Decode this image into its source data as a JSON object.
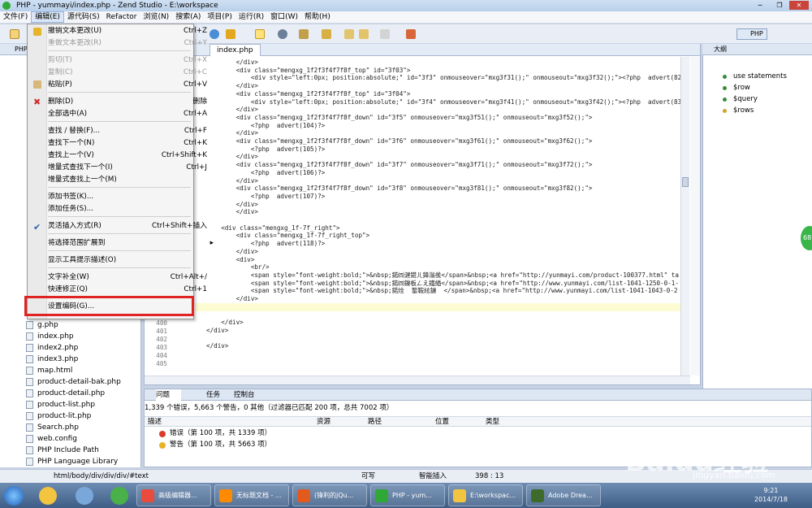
{
  "window": {
    "title": "PHP - yummayi/index.php - Zend Studio - E:\\workspace"
  },
  "menubar": [
    "文件(F)",
    "编辑(E)",
    "源代码(S)",
    "Refactor",
    "浏览(N)",
    "搜索(A)",
    "项目(P)",
    "运行(R)",
    "窗口(W)",
    "帮助(H)"
  ],
  "perspective": "PHP",
  "edit_menu": {
    "items": [
      {
        "label": "撤销文本更改(U)",
        "shortcut": "Ctrl+Z",
        "disabled": false
      },
      {
        "label": "重做文本更改(R)",
        "shortcut": "Ctrl+Y",
        "disabled": true
      },
      {
        "label": "剪切(T)",
        "shortcut": "Ctrl+X",
        "disabled": true
      },
      {
        "label": "复制(C)",
        "shortcut": "Ctrl+C",
        "disabled": true
      },
      {
        "label": "粘贴(P)",
        "shortcut": "Ctrl+V",
        "disabled": false
      },
      {
        "label": "删除(D)",
        "shortcut": "删除",
        "disabled": false
      },
      {
        "label": "全部选中(A)",
        "shortcut": "Ctrl+A",
        "disabled": false
      },
      {
        "label": "查找 / 替换(F)...",
        "shortcut": "Ctrl+F",
        "disabled": false
      },
      {
        "label": "查找下一个(N)",
        "shortcut": "Ctrl+K",
        "disabled": false
      },
      {
        "label": "查找上一个(V)",
        "shortcut": "Ctrl+Shift+K",
        "disabled": false
      },
      {
        "label": "增量式查找下一个(I)",
        "shortcut": "Ctrl+J",
        "disabled": false
      },
      {
        "label": "增量式查找上一个(M)",
        "shortcut": "",
        "disabled": false
      },
      {
        "label": "添加书签(K)...",
        "shortcut": "",
        "disabled": false
      },
      {
        "label": "添加任务(S)...",
        "shortcut": "",
        "disabled": false
      },
      {
        "label": "灵活插入方式(R)",
        "shortcut": "Ctrl+Shift+插入",
        "disabled": false
      },
      {
        "label": "将选择范围扩展到",
        "shortcut": "",
        "disabled": false
      },
      {
        "label": "显示工具提示描述(O)",
        "shortcut": "",
        "disabled": false
      },
      {
        "label": "文字补全(W)",
        "shortcut": "Ctrl+Alt+/",
        "disabled": false
      },
      {
        "label": "快速修正(Q)",
        "shortcut": "Ctrl+1",
        "disabled": false
      },
      {
        "label": "设置编码(G)...",
        "shortcut": "",
        "disabled": false
      }
    ]
  },
  "left_panel": {
    "tab": "PHP",
    "files": [
      "g.php",
      "index.php",
      "index2.php",
      "index3.php",
      "map.html",
      "product-detail-bak.php",
      "product-detail.php",
      "product-list.php",
      "product-lit.php",
      "Search.php",
      "web.config",
      "PHP Include Path",
      "PHP Language Library"
    ]
  },
  "editor": {
    "tab": "index.php",
    "code_lines": [
      "        </div>",
      "        <div class=\"mengxg_1f2f3f4f7f8f_top\" id=\"3f03\">",
      "            <div style=\"left:0px; position:absolute;\" id=\"3f3\" onmouseover=\"mxg3f31();\" onmouseout=\"mxg3f32();\"><?php  advert(82)",
      "        </div>",
      "        <div class=\"mengxg_1f2f3f4f7f8f_top\" id=\"3f04\">",
      "            <div style=\"left:0px; position:absolute;\" id=\"3f4\" onmouseover=\"mxg3f41();\" onmouseout=\"mxg3f42();\"><?php  advert(83)",
      "        </div>",
      "        <div class=\"mengxg_1f2f3f4f7f8f_down\" id=\"3f5\" onmouseover=\"mxg3f51();\" onmouseout=\"mxg3f52();\">",
      "            <?php  advert(104)?>",
      "        </div>",
      "        <div class=\"mengxg_1f2f3f4f7f8f_down\" id=\"3f6\" onmouseover=\"mxg3f61();\" onmouseout=\"mxg3f62();\">",
      "            <?php  advert(105)?>",
      "        </div>",
      "        <div class=\"mengxg_1f2f3f4f7f8f_down\" id=\"3f7\" onmouseover=\"mxg3f71();\" onmouseout=\"mxg3f72();\">",
      "            <?php  advert(106)?>",
      "        </div>",
      "        <div class=\"mengxg_1f2f3f4f7f8f_down\" id=\"3f8\" onmouseover=\"mxg3f81();\" onmouseout=\"mxg3f82();\">",
      "            <?php  advert(107)?>",
      "        </div>",
      "        </div>",
      "",
      "    <div class=\"mengxg_1f-7f_right\">",
      "        <div class=\"mengxg_1f-7f_right_top\">",
      "            <?php  advert(118)?>",
      "        </div>",
      "        <div>",
      "            <br/>",
      "            <span style=\"font-weight:bold;\">&nbsp;鍩㈣湕鍣ㄦ鍏滃彂</span>&nbsp;<a href=\"http://yunmayi.com/product-100377.html\" ta",
      "            <span style=\"font-weight:bold;\">&nbsp;鍩㈣鏁板ㄥえ鐵緍</span>&nbsp;<a href=\"http://www.yunmayi.com/list-1041-1250-0-1-",
      "            <span style=\"font-weight:bold;\">&nbsp;鍩烇  鐜鞍絃鐪  </span>&nbsp;<a href=\"http://www.yunmayi.com/list-1041-1043-0-2",
      "        </div>",
      "    </div>",
      "",
      "    </div>",
      "</div>",
      "",
      "</div>",
      ""
    ],
    "line_numbers": [
      "400",
      "401",
      "402",
      "403",
      "404",
      "405"
    ]
  },
  "outline": {
    "tab": "大纲",
    "items": [
      "use statements",
      "$row",
      "$query",
      "$rows"
    ]
  },
  "bottom_panel": {
    "tabs": [
      "问题",
      "任务",
      "控制台"
    ],
    "status": "1,339 个错误，5,663 个警告，0 其他（过滤器已匹配 200 项，总共 7002 项）",
    "columns": [
      "描述",
      "资源",
      "路径",
      "位置",
      "类型"
    ],
    "rows": [
      "错误（第 100 项，共 1339 项）",
      "警告（第 100 项，共 5663 项）"
    ]
  },
  "statusbar": {
    "path": "html/body/div/div/div/#text",
    "writable": "可写",
    "insert_mode": "智能插入",
    "position": "398 : 13"
  },
  "taskbar": {
    "tasks": [
      "高级编辑器...",
      "无标题文档 - ...",
      "(锋利的jQu...",
      "PHP - yum...",
      "E:\\workspac...",
      "Adobe Drea..."
    ],
    "time": "9:21",
    "date": "2014/7/18"
  },
  "watermark": {
    "logo": "Baidu经验",
    "url": "jingyan.baidu.com"
  },
  "badge": "68",
  "colors": {
    "highlight": "#e02424",
    "accent": "#3a6ea5"
  }
}
